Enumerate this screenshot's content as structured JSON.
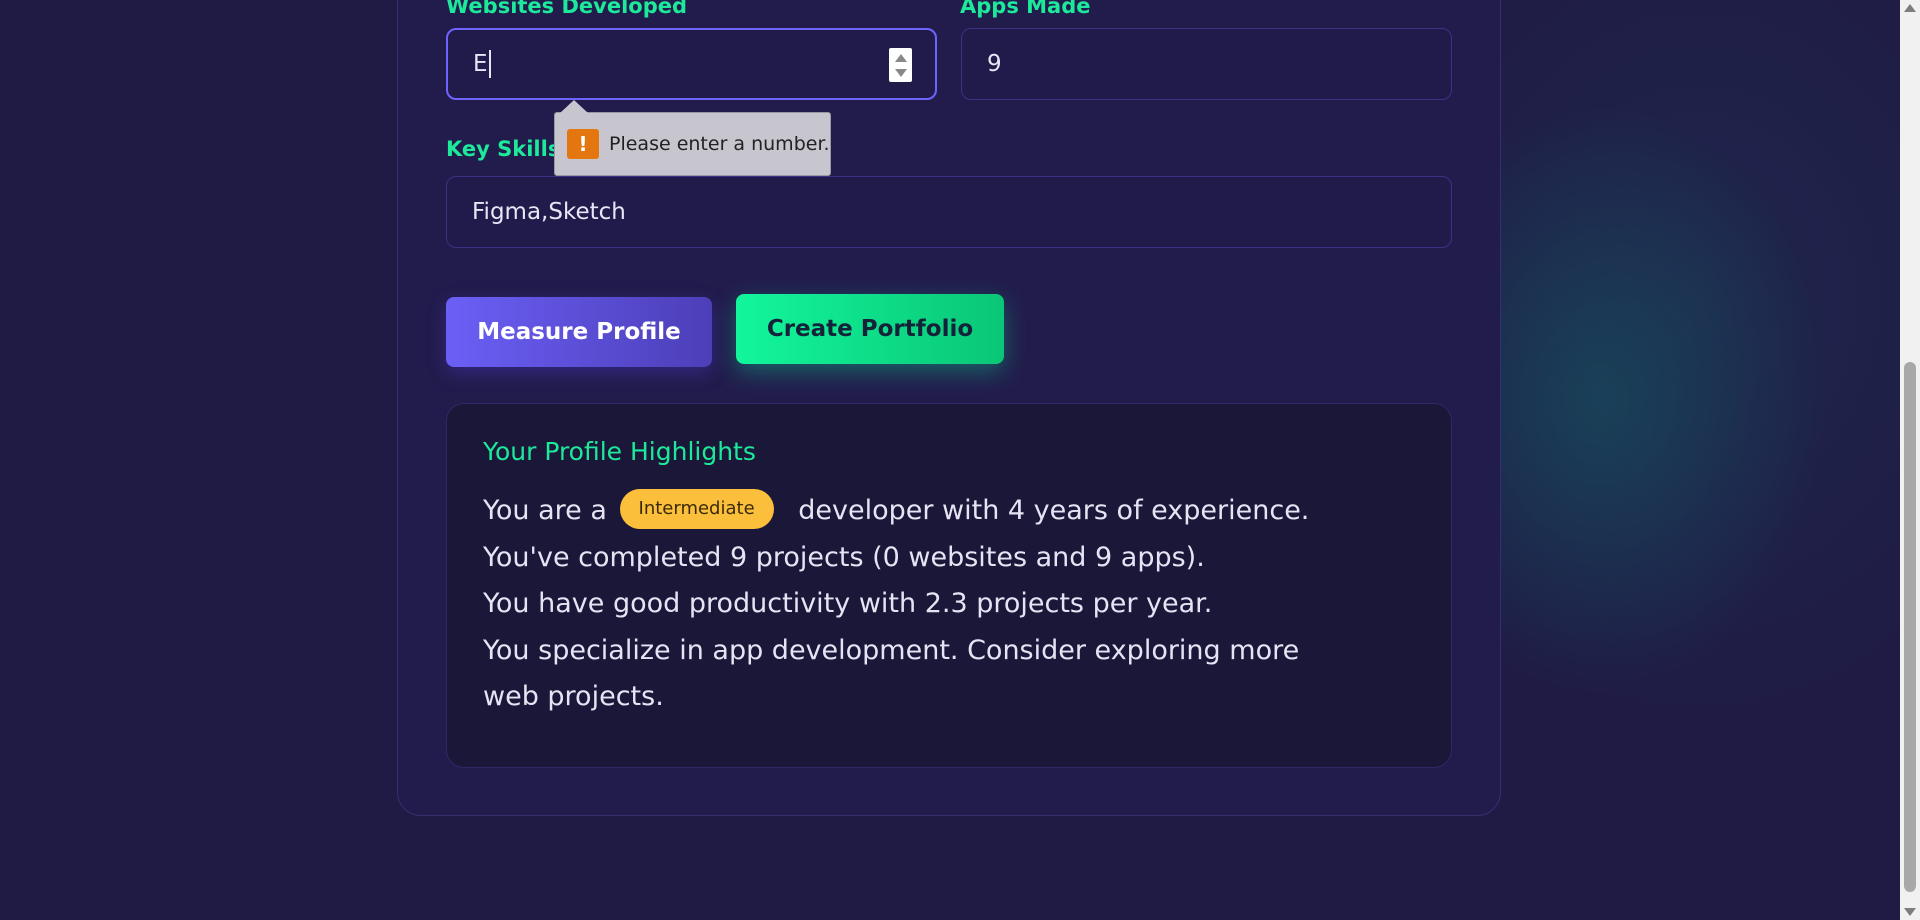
{
  "form": {
    "websites_label": "Websites Developed",
    "websites_value": "E",
    "apps_label": "Apps Made",
    "apps_value": "9",
    "skills_label": "Key Skills (comma-separated)",
    "skills_value": "Figma,Sketch",
    "validation_message": "Please enter a number."
  },
  "actions": {
    "measure_label": "Measure Profile",
    "create_label": "Create Portfolio"
  },
  "highlights": {
    "title": "Your Profile Highlights",
    "line1_prefix": "You are a",
    "level_badge": "Intermediate",
    "line1_suffix": "developer with 4 years of experience.",
    "line2": "You've completed 9 projects (0 websites and 9 apps).",
    "line3": "You have good productivity with 2.3 projects per year.",
    "line4": "You specialize in app development. Consider exploring more web projects."
  },
  "colors": {
    "accent_green": "#1de99b",
    "accent_purple": "#6b5ff6",
    "badge_yellow": "#fbbf3c",
    "background": "#1f1b45"
  },
  "icons": {
    "warning": "warning-icon",
    "spinner_up": "chevron-up-icon",
    "spinner_down": "chevron-down-icon"
  }
}
